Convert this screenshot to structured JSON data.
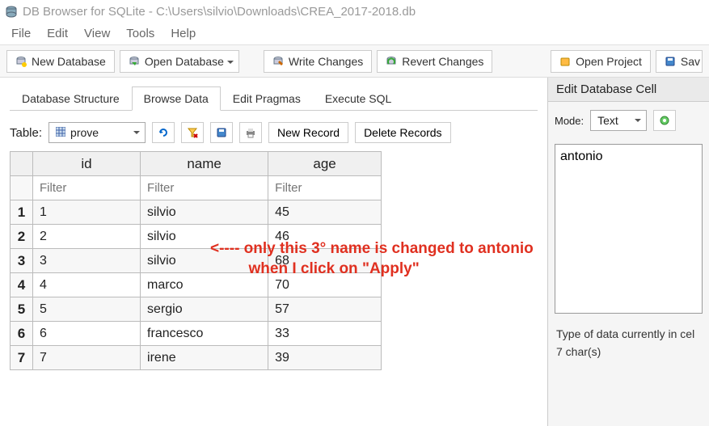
{
  "window_title": "DB Browser for SQLite - C:\\Users\\silvio\\Downloads\\CREA_2017-2018.db",
  "menu": {
    "file": "File",
    "edit": "Edit",
    "view": "View",
    "tools": "Tools",
    "help": "Help"
  },
  "toolbar": {
    "new_db": "New Database",
    "open_db": "Open Database",
    "write": "Write Changes",
    "revert": "Revert Changes",
    "open_project": "Open Project",
    "save": "Sav"
  },
  "tabs": {
    "db_structure": "Database Structure",
    "browse": "Browse Data",
    "pragmas": "Edit Pragmas",
    "execute": "Execute SQL"
  },
  "browse": {
    "table_label": "Table:",
    "table_value": "prove",
    "new_record": "New Record",
    "delete_records": "Delete Records"
  },
  "grid": {
    "columns": [
      "id",
      "name",
      "age"
    ],
    "filter_placeholder": "Filter",
    "rows": [
      {
        "n": "1",
        "id": "1",
        "name": "silvio",
        "age": "45"
      },
      {
        "n": "2",
        "id": "2",
        "name": "silvio",
        "age": "46"
      },
      {
        "n": "3",
        "id": "3",
        "name": "silvio",
        "age": "68"
      },
      {
        "n": "4",
        "id": "4",
        "name": "marco",
        "age": "70"
      },
      {
        "n": "5",
        "id": "5",
        "name": "sergio",
        "age": "57"
      },
      {
        "n": "6",
        "id": "6",
        "name": "francesco",
        "age": "33"
      },
      {
        "n": "7",
        "id": "7",
        "name": "irene",
        "age": "39"
      }
    ]
  },
  "annotation": {
    "line1": "<---- only this 3° name is changed to antonio",
    "line2": "when I click on \"Apply\""
  },
  "cellpanel": {
    "title": "Edit Database Cell",
    "mode_label": "Mode:",
    "mode_value": "Text",
    "value": "antonio",
    "typeinfo": "Type of data currently in cel",
    "sizeinfo": "7 char(s)"
  }
}
